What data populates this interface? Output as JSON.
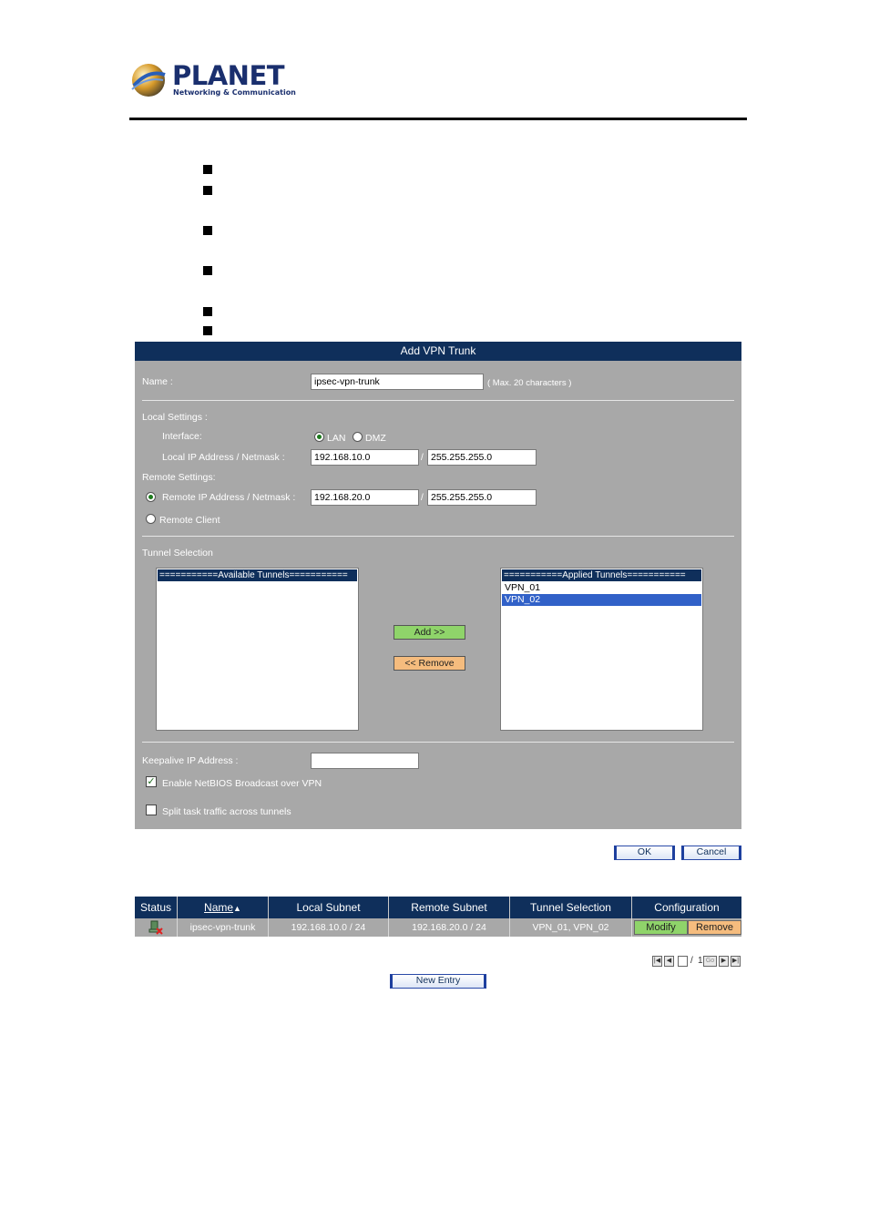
{
  "brand": {
    "name": "PLANET",
    "tagline": "Networking & Communication"
  },
  "panel": {
    "title": "Add VPN Trunk",
    "name_label": "Name :",
    "name_value": "ipsec-vpn-trunk",
    "name_hint": "( Max. 20 characters )",
    "local_settings_label": "Local Settings :",
    "interface_label": "Interface:",
    "interface_options": [
      "LAN",
      "DMZ"
    ],
    "interface_selected": "LAN",
    "local_ip_label": "Local IP Address / Netmask :",
    "local_ip": "192.168.10.0",
    "local_mask": "255.255.255.0",
    "remote_settings_label": "Remote Settings:",
    "remote_ip_label": "Remote IP Address / Netmask :",
    "remote_ip": "192.168.20.0",
    "remote_mask": "255.255.255.0",
    "remote_client_label": "Remote Client",
    "slash": "/",
    "tunnel_selection_label": "Tunnel Selection",
    "available_header": "===========Available Tunnels===========",
    "applied_header": "===========Applied Tunnels===========",
    "applied_items": [
      "VPN_01",
      "VPN_02"
    ],
    "applied_selected": "VPN_02",
    "add_button": "Add >>",
    "remove_button": "<< Remove",
    "keepalive_label": "Keepalive IP Address :",
    "keepalive_value": "",
    "netbios_label": "Enable NetBIOS Broadcast over VPN",
    "netbios_checked": true,
    "split_label": "Split task traffic across tunnels",
    "split_checked": false
  },
  "actions": {
    "ok": "OK",
    "cancel": "Cancel",
    "new_entry": "New Entry"
  },
  "table": {
    "headers": {
      "status": "Status",
      "name": "Name",
      "local_subnet": "Local Subnet",
      "remote_subnet": "Remote Subnet",
      "tunnel_selection": "Tunnel Selection",
      "configuration": "Configuration"
    },
    "row": {
      "name": "ipsec-vpn-trunk",
      "local_subnet": "192.168.10.0 / 24",
      "remote_subnet": "192.168.20.0 / 24",
      "tunnel_selection": "VPN_01, VPN_02",
      "modify": "Modify",
      "remove": "Remove"
    },
    "pager": {
      "current": "1",
      "separator": "/",
      "total": "1",
      "go": "Go"
    }
  },
  "colors": {
    "header_bg": "#0f2f5b",
    "panel_bg": "#a8a8a8",
    "add_green": "#8fd46a",
    "remove_orange": "#f5bc7e",
    "selection_blue": "#3161c8"
  }
}
